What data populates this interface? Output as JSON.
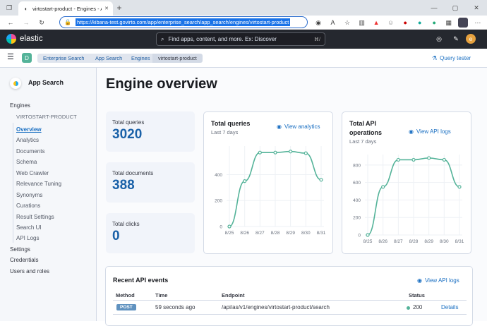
{
  "browser": {
    "tab_title": "virtostart-product - Engines - App Search",
    "close_glyph": "✕",
    "new_tab_glyph": "+",
    "url": "https://kibana-test.govirto.com/app/enterprise_search/app_search/engines/virtostart-product"
  },
  "kibana": {
    "logo_text": "elastic",
    "search_placeholder": "Find apps, content, and more. Ex: Discover",
    "search_shortcut": "⌘/",
    "space_letter": "D",
    "user_initial": "e",
    "query_tester": "Query tester"
  },
  "breadcrumbs": [
    "Enterprise Search",
    "App Search",
    "Engines",
    "virtostart-product"
  ],
  "sidebar": {
    "title": "App Search",
    "engines": "Engines",
    "engine_name": "VIRTOSTART-PRODUCT",
    "items": [
      "Overview",
      "Analytics",
      "Documents",
      "Schema",
      "Web Crawler",
      "Relevance Tuning",
      "Synonyms",
      "Curations",
      "Result Settings",
      "Search UI",
      "API Logs"
    ],
    "bottom": [
      "Settings",
      "Credentials",
      "Users and roles"
    ]
  },
  "page": {
    "title": "Engine overview",
    "stats": [
      {
        "label": "Total queries",
        "value": "3020"
      },
      {
        "label": "Total documents",
        "value": "388"
      },
      {
        "label": "Total clicks",
        "value": "0"
      }
    ],
    "queries_card": {
      "title": "Total queries",
      "subtitle": "Last 7 days",
      "link": "View analytics"
    },
    "api_card": {
      "title_line1": "Total API",
      "title_line2": "operations",
      "subtitle": "Last 7 days",
      "link": "View API logs"
    },
    "events": {
      "title": "Recent API events",
      "link": "View API logs",
      "columns": [
        "Method",
        "Time",
        "Endpoint",
        "Status"
      ],
      "row": {
        "method": "POST",
        "time": "59 seconds ago",
        "endpoint": "/api/as/v1/engines/virtostart-product/search",
        "status": "200",
        "action": "Details"
      }
    }
  },
  "colors": {
    "accent": "#1a6fc2",
    "line": "#54b399",
    "header": "#25282f"
  },
  "chart_data": [
    {
      "type": "line",
      "title": "Total queries",
      "x": [
        "8/25",
        "8/26",
        "8/27",
        "8/28",
        "8/29",
        "8/30",
        "8/31"
      ],
      "series": [
        {
          "values": [
            0,
            350,
            570,
            570,
            578,
            565,
            360
          ]
        }
      ],
      "yticks": [
        0,
        200,
        400
      ],
      "ylim": [
        0,
        620
      ]
    },
    {
      "type": "line",
      "title": "Total API operations",
      "x": [
        "8/25",
        "8/26",
        "8/27",
        "8/28",
        "8/29",
        "8/30",
        "8/31"
      ],
      "series": [
        {
          "values": [
            0,
            550,
            860,
            860,
            880,
            860,
            550
          ]
        }
      ],
      "yticks": [
        0,
        200,
        400,
        600,
        800
      ],
      "ylim": [
        0,
        920
      ]
    }
  ]
}
